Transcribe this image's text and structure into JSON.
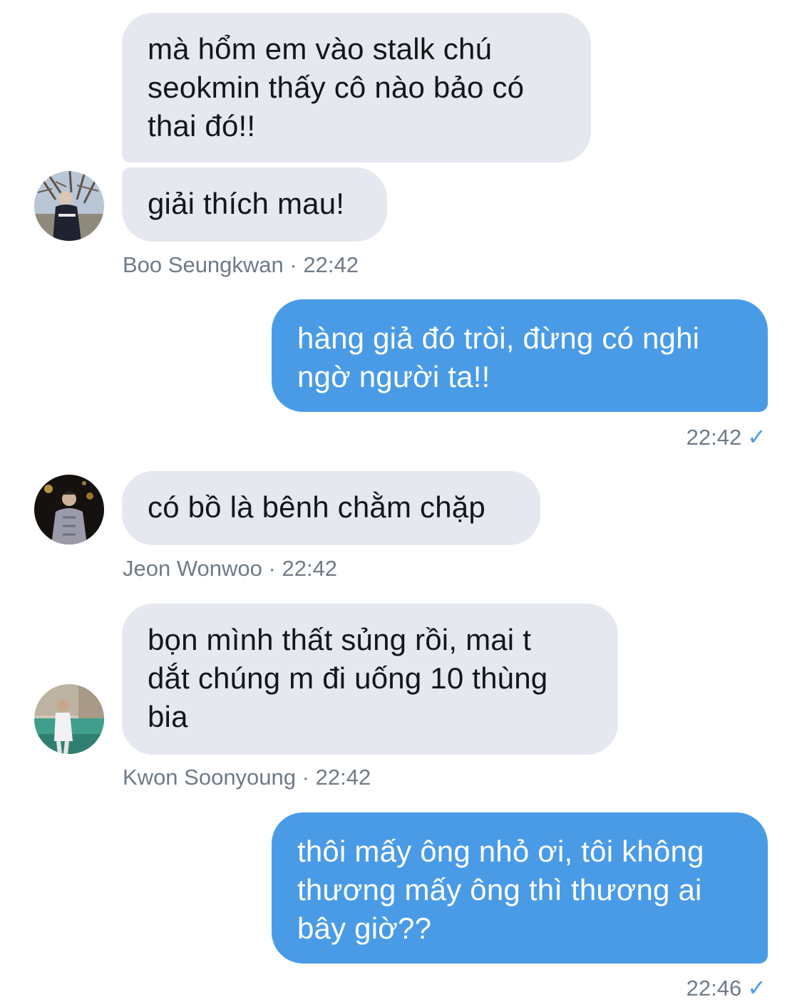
{
  "messages": [
    {
      "sender": "Boo Seungkwan",
      "time": "22:42",
      "texts": [
        "mà hổm em vào stalk chú\nseokmin thấy cô nào bảo có\nthai đó!!",
        "giải thích mau!"
      ]
    },
    {
      "outgoing": true,
      "text": "hàng giả đó tròi, đừng có nghi\nngờ người ta!!",
      "time": "22:42",
      "status_icon": "checkmark-icon"
    },
    {
      "sender": "Jeon Wonwoo",
      "time": "22:42",
      "texts": [
        "có bồ là bênh chằm chặp"
      ]
    },
    {
      "sender": "Kwon Soonyoung",
      "time": "22:42",
      "texts": [
        "bọn mình thất sủng rồi, mai t\ndắt chúng m đi uống 10 thùng\nbia"
      ]
    },
    {
      "outgoing": true,
      "text": "thôi mấy ông nhỏ ơi, tôi không\nthương mấy ông thì thương ai\nbây giờ??",
      "time": "22:46",
      "status_icon": "checkmark-icon"
    }
  ],
  "meta_separator": "·",
  "check_glyph": "✓",
  "colors": {
    "incoming_bubble": "#e6e8ef",
    "outgoing_bubble": "#4a9be6",
    "meta_text": "#6f7b87",
    "read_check": "#4a9be6"
  }
}
